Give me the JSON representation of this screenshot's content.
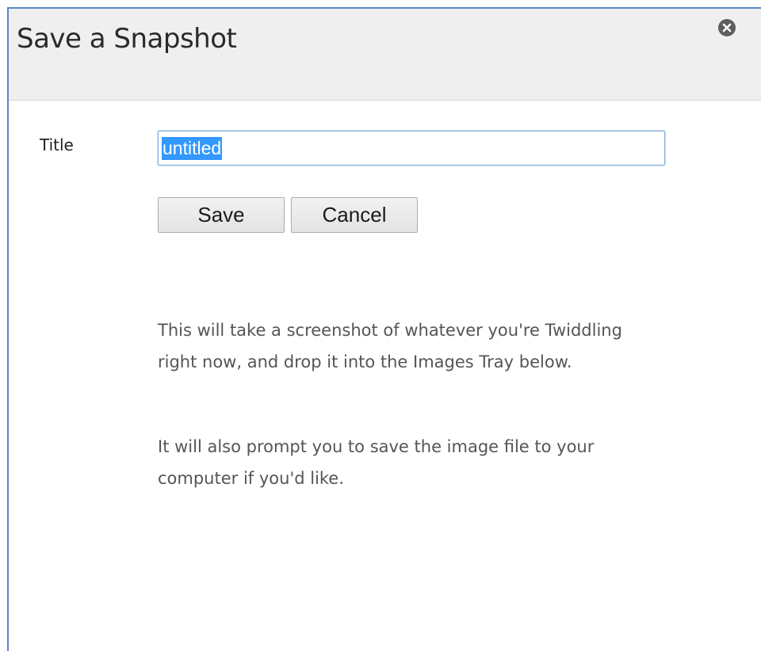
{
  "dialog": {
    "title": "Save a Snapshot",
    "close_icon": "close-circle-icon"
  },
  "form": {
    "title_label": "Title",
    "title_value": "untitled",
    "title_value_selected": true,
    "save_label": "Save",
    "cancel_label": "Cancel"
  },
  "description": {
    "paragraph_1": "This will take a screenshot of whatever you're Twiddling right now, and drop it into the Images Tray below.",
    "paragraph_2": "It will also prompt you to save the image file to your computer if you'd like."
  },
  "colors": {
    "dialog_border": "#5b87c4",
    "header_background": "#efefef",
    "input_focus_border": "#7ea7dc",
    "selection_highlight": "#3399ff",
    "description_text": "#555555"
  }
}
